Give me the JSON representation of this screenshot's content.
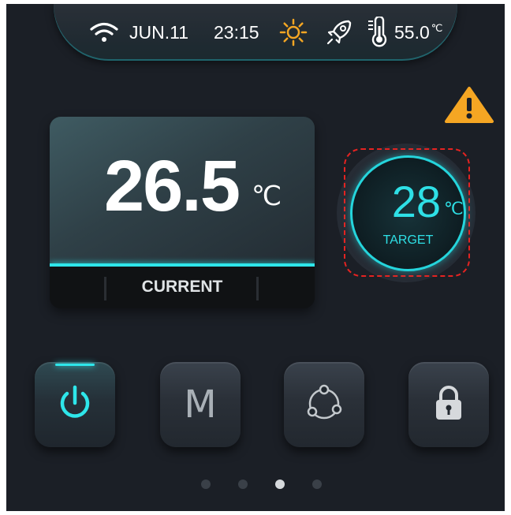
{
  "status_bar": {
    "wifi_icon": "wifi-icon",
    "date": "JUN.11",
    "time": "23:15",
    "weather_icon": "sun-icon",
    "mode_icon": "rocket-icon",
    "thermometer_icon": "thermometer-icon",
    "water_temp": "55.0",
    "water_temp_unit": "℃"
  },
  "alert": {
    "icon": "warning-icon",
    "color": "#f5a623"
  },
  "current": {
    "value": "26.5",
    "unit": "℃",
    "label": "CURRENT"
  },
  "target": {
    "value": "28",
    "unit": "℃",
    "label": "TARGET"
  },
  "buttons": [
    {
      "icon": "power-icon",
      "active": true
    },
    {
      "label": "M",
      "icon": "mode-icon"
    },
    {
      "icon": "cycle-icon"
    },
    {
      "icon": "lock-icon"
    }
  ],
  "pagination": {
    "count": 4,
    "active_index": 2
  },
  "colors": {
    "accent": "#2ee6ea",
    "background": "#1b1f26",
    "warning": "#f5a623",
    "highlight_outline": "#e52321"
  }
}
